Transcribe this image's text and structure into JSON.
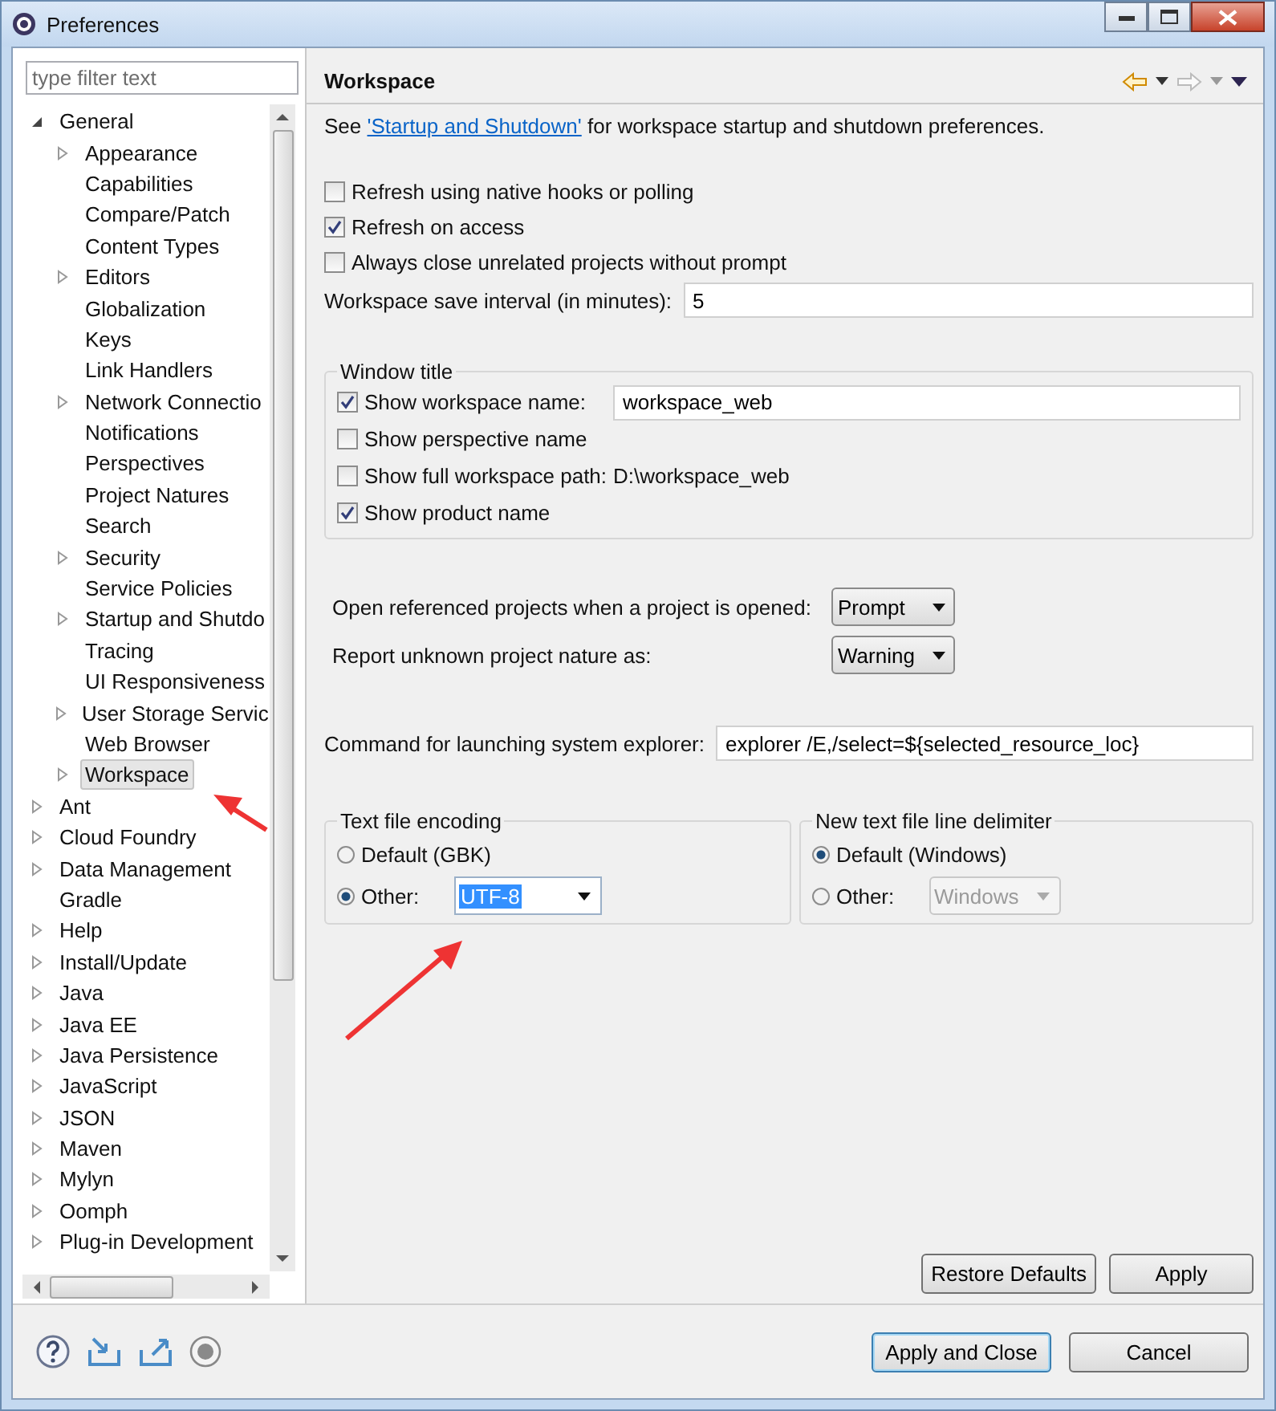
{
  "window": {
    "title": "Preferences"
  },
  "filter": {
    "placeholder": "type filter text"
  },
  "tree": [
    {
      "label": "General",
      "expandable": true,
      "expanded": true,
      "selected": false,
      "children": [
        {
          "label": "Appearance",
          "expandable": true,
          "expanded": false,
          "selected": false
        },
        {
          "label": "Capabilities",
          "expandable": false,
          "selected": false
        },
        {
          "label": "Compare/Patch",
          "expandable": false,
          "selected": false
        },
        {
          "label": "Content Types",
          "expandable": false,
          "selected": false
        },
        {
          "label": "Editors",
          "expandable": true,
          "expanded": false,
          "selected": false
        },
        {
          "label": "Globalization",
          "expandable": false,
          "selected": false
        },
        {
          "label": "Keys",
          "expandable": false,
          "selected": false
        },
        {
          "label": "Link Handlers",
          "expandable": false,
          "selected": false
        },
        {
          "label": "Network Connectio",
          "expandable": true,
          "expanded": false,
          "selected": false
        },
        {
          "label": "Notifications",
          "expandable": false,
          "selected": false
        },
        {
          "label": "Perspectives",
          "expandable": false,
          "selected": false
        },
        {
          "label": "Project Natures",
          "expandable": false,
          "selected": false
        },
        {
          "label": "Search",
          "expandable": false,
          "selected": false
        },
        {
          "label": "Security",
          "expandable": true,
          "expanded": false,
          "selected": false
        },
        {
          "label": "Service Policies",
          "expandable": false,
          "selected": false
        },
        {
          "label": "Startup and Shutdo",
          "expandable": true,
          "expanded": false,
          "selected": false
        },
        {
          "label": "Tracing",
          "expandable": false,
          "selected": false
        },
        {
          "label": "UI Responsiveness",
          "expandable": false,
          "selected": false
        },
        {
          "label": "User Storage Servic",
          "expandable": true,
          "expanded": false,
          "selected": false
        },
        {
          "label": "Web Browser",
          "expandable": false,
          "selected": false
        },
        {
          "label": "Workspace",
          "expandable": true,
          "expanded": false,
          "selected": true
        }
      ]
    },
    {
      "label": "Ant",
      "expandable": true,
      "expanded": false,
      "selected": false
    },
    {
      "label": "Cloud Foundry",
      "expandable": true,
      "expanded": false,
      "selected": false
    },
    {
      "label": "Data Management",
      "expandable": true,
      "expanded": false,
      "selected": false
    },
    {
      "label": "Gradle",
      "expandable": false,
      "selected": false
    },
    {
      "label": "Help",
      "expandable": true,
      "expanded": false,
      "selected": false
    },
    {
      "label": "Install/Update",
      "expandable": true,
      "expanded": false,
      "selected": false
    },
    {
      "label": "Java",
      "expandable": true,
      "expanded": false,
      "selected": false
    },
    {
      "label": "Java EE",
      "expandable": true,
      "expanded": false,
      "selected": false
    },
    {
      "label": "Java Persistence",
      "expandable": true,
      "expanded": false,
      "selected": false
    },
    {
      "label": "JavaScript",
      "expandable": true,
      "expanded": false,
      "selected": false
    },
    {
      "label": "JSON",
      "expandable": true,
      "expanded": false,
      "selected": false
    },
    {
      "label": "Maven",
      "expandable": true,
      "expanded": false,
      "selected": false
    },
    {
      "label": "Mylyn",
      "expandable": true,
      "expanded": false,
      "selected": false
    },
    {
      "label": "Oomph",
      "expandable": true,
      "expanded": false,
      "selected": false
    },
    {
      "label": "Plug-in Development",
      "expandable": true,
      "expanded": false,
      "selected": false
    }
  ],
  "page": {
    "title": "Workspace",
    "intro": {
      "before": "See ",
      "link": "'Startup and Shutdown'",
      "after": " for workspace startup and shutdown preferences."
    },
    "options": [
      {
        "label": "Refresh using native hooks or polling",
        "checked": false
      },
      {
        "label": "Refresh on access",
        "checked": true
      },
      {
        "label": "Always close unrelated projects without prompt",
        "checked": false
      }
    ],
    "save_interval": {
      "label": "Workspace save interval (in minutes):",
      "value": "5"
    },
    "window_title": {
      "title": "Window title",
      "options": [
        {
          "kind": "field",
          "label": "Show workspace name:",
          "checked": true,
          "value": "workspace_web"
        },
        {
          "kind": "plain",
          "label": "Show perspective name",
          "checked": false
        },
        {
          "kind": "path",
          "label": "Show full workspace path:",
          "checked": false,
          "value": "D:\\workspace_web"
        },
        {
          "kind": "plain",
          "label": "Show product name",
          "checked": true
        }
      ]
    },
    "dropdowns": [
      {
        "label": "Open referenced projects when a project is opened:",
        "value": "Prompt"
      },
      {
        "label": "Report unknown project nature as:",
        "value": "Warning"
      }
    ],
    "explorer": {
      "label": "Command for launching system explorer:",
      "value": "explorer /E,/select=${selected_resource_loc}"
    },
    "encoding": {
      "title": "Text file encoding",
      "options": [
        {
          "label": "Default (GBK)",
          "selected": false
        },
        {
          "label": "Other:",
          "selected": true,
          "value": "UTF-8"
        }
      ]
    },
    "delimiter": {
      "title": "New text file line delimiter",
      "options": [
        {
          "label": "Default (Windows)",
          "selected": true
        },
        {
          "label": "Other:",
          "selected": false,
          "value": "Windows"
        }
      ]
    },
    "buttons": [
      "Restore Defaults",
      "Apply"
    ]
  },
  "dialog_buttons": [
    {
      "label": "Apply and Close",
      "default": true
    },
    {
      "label": "Cancel",
      "default": false
    }
  ]
}
